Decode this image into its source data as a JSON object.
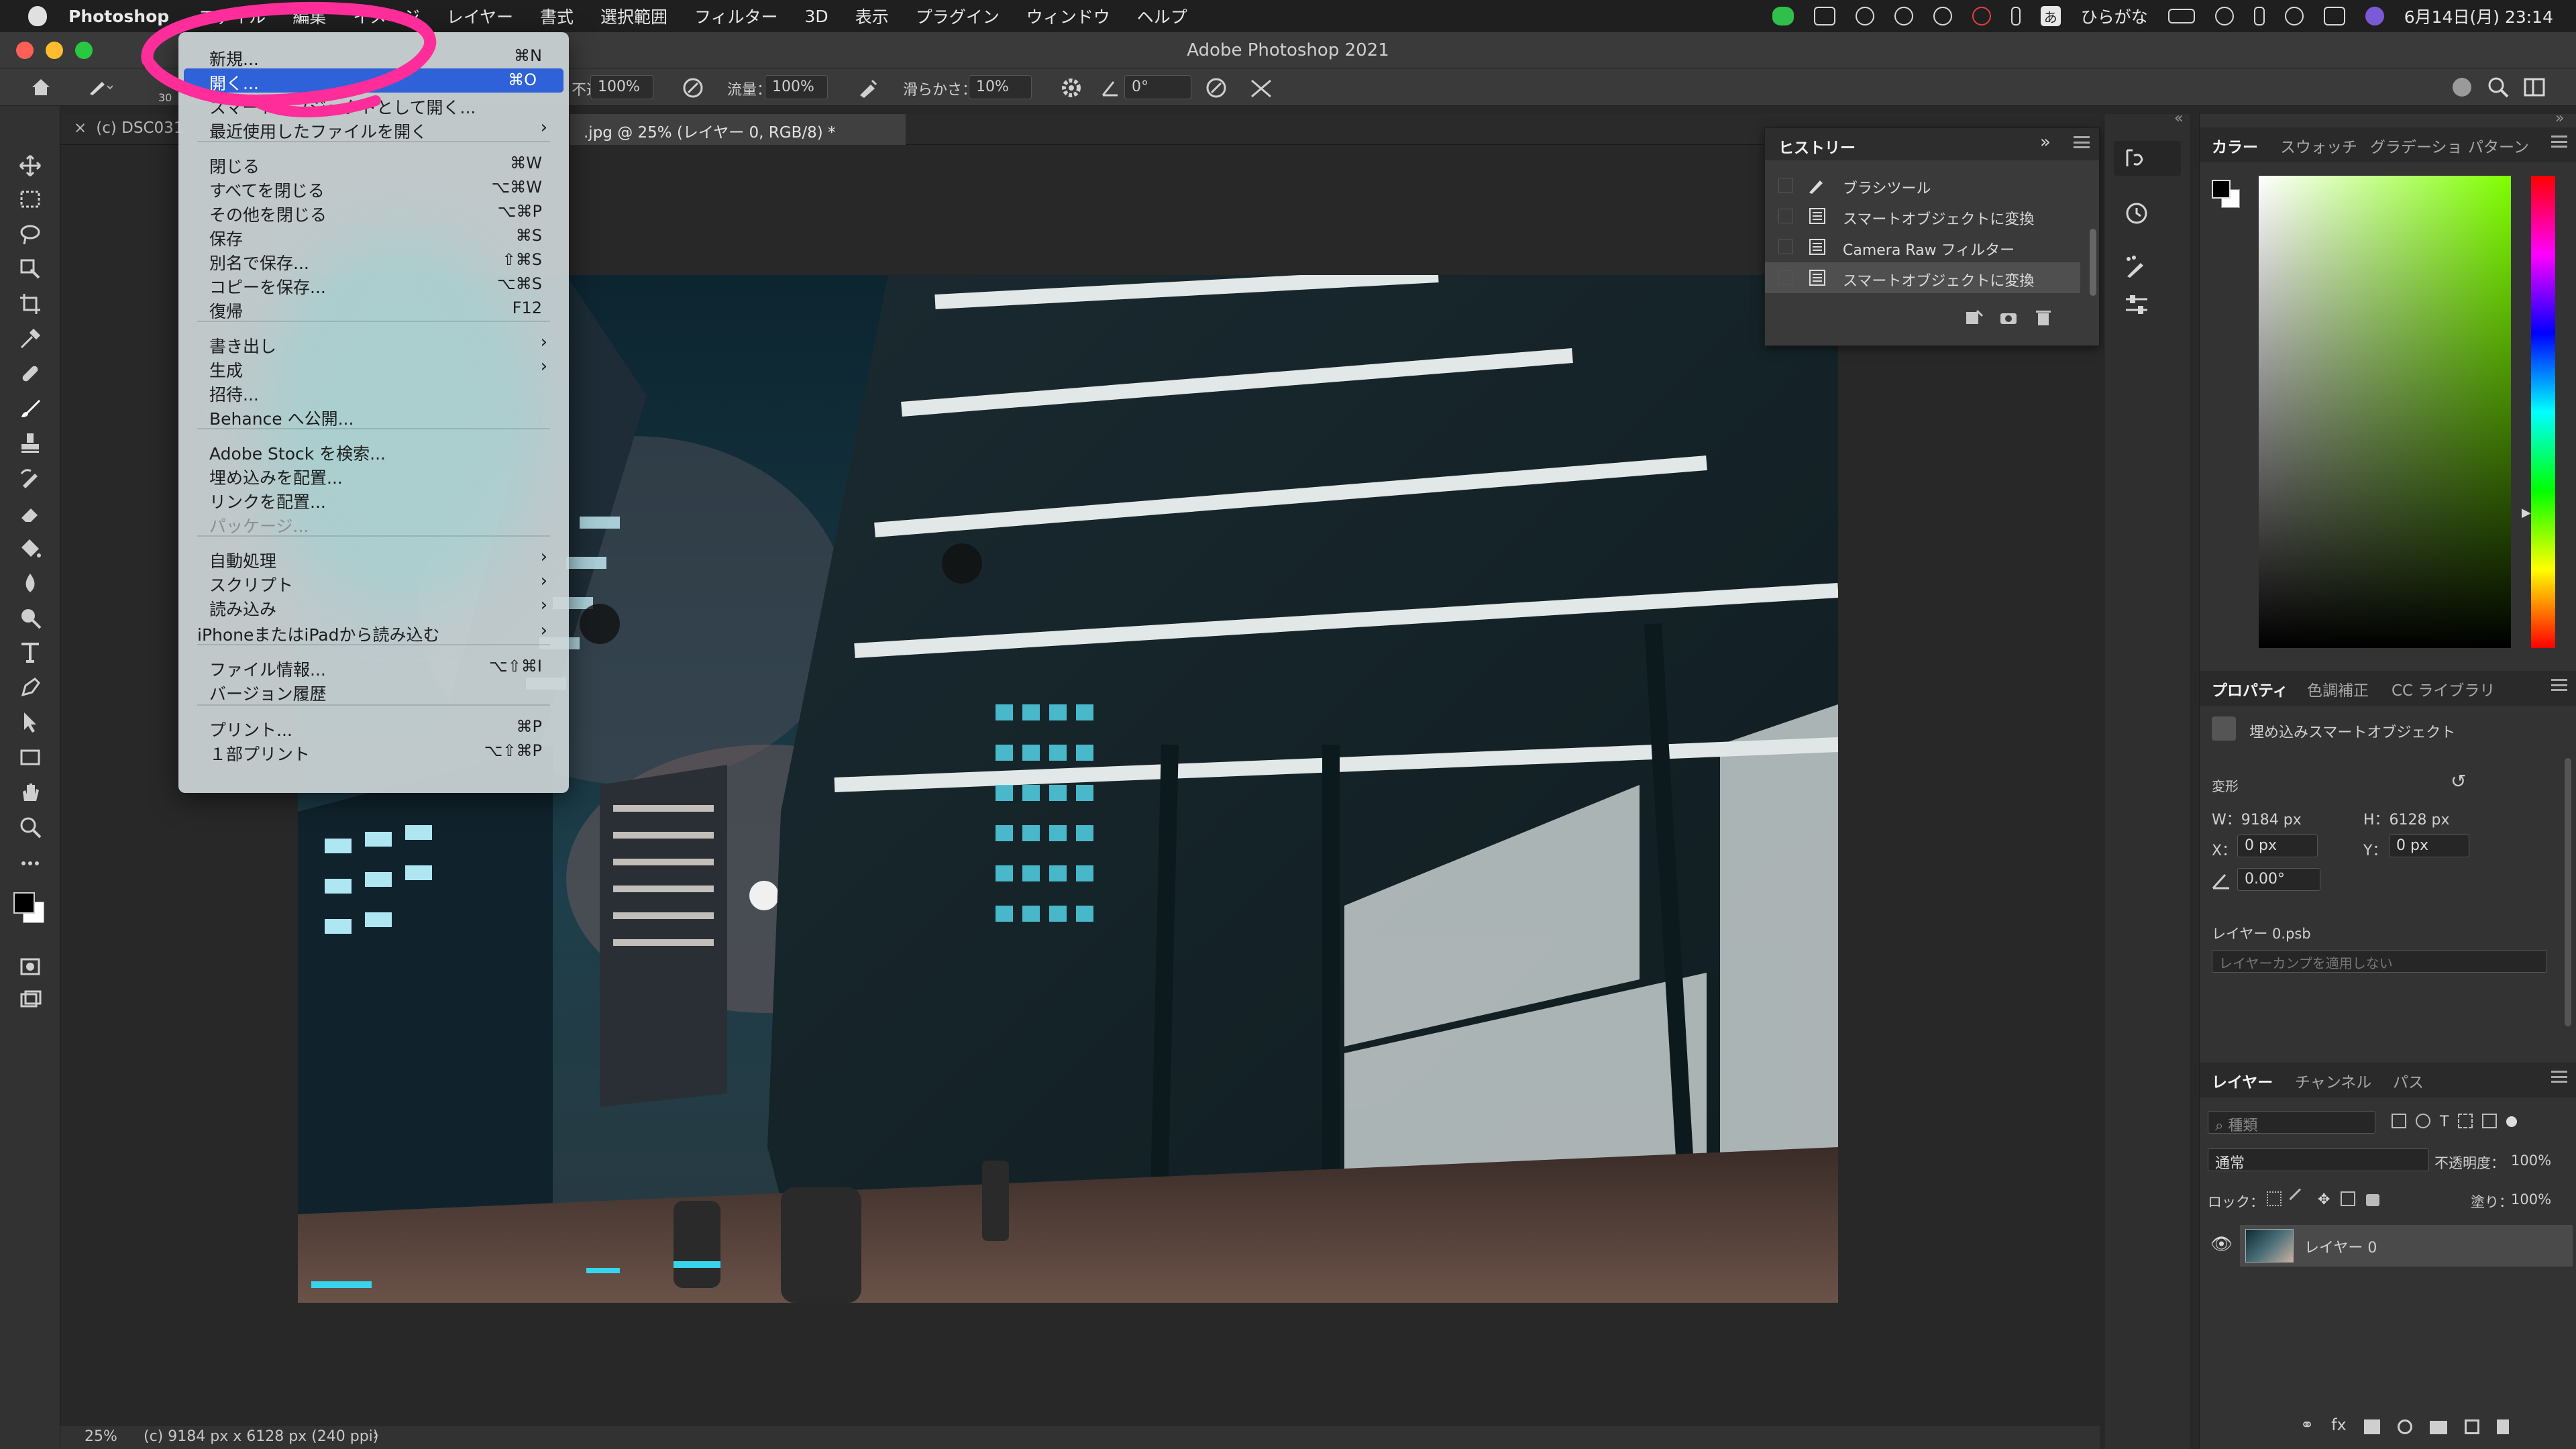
{
  "menubar": {
    "app": "Photoshop",
    "items": [
      "ファイル",
      "編集",
      "イメージ",
      "レイヤー",
      "書式",
      "選択範囲",
      "フィルター",
      "3D",
      "表示",
      "プラグイン",
      "ウィンドウ",
      "ヘルプ"
    ],
    "ime": "ひらがな",
    "ime_badge": "あ",
    "datetime": "6月14日(月)  23:14"
  },
  "window": {
    "title": "Adobe Photoshop 2021"
  },
  "options_bar": {
    "brush_size": "30",
    "opacity_label": "不透明度：",
    "opacity_value": "100%",
    "flow_label": "流量：",
    "flow_value": "100%",
    "smoothing_label": "滑らかさ：",
    "smoothing_value": "10%",
    "angle_value": "0°"
  },
  "tabs": {
    "tab1": "(c) DSC031",
    "tab2": ".jpg @ 25% (レイヤー 0, RGB/8) *"
  },
  "status_bar": {
    "zoom": "25%",
    "doc_info": "(c) 9184 px x 6128 px (240 ppi)"
  },
  "file_menu": {
    "items": [
      {
        "label": "新規...",
        "shortcut": "⌘N"
      },
      {
        "label": "開く...",
        "shortcut": "⌘O"
      },
      {
        "label": "スマートオブジェクトとして開く...",
        "shortcut": ""
      },
      {
        "label": "最近使用したファイルを開く",
        "shortcut": "›"
      },
      {
        "label": "閉じる",
        "shortcut": "⌘W"
      },
      {
        "label": "すべてを閉じる",
        "shortcut": "⌥⌘W"
      },
      {
        "label": "その他を閉じる",
        "shortcut": "⌥⌘P"
      },
      {
        "label": "保存",
        "shortcut": "⌘S"
      },
      {
        "label": "別名で保存...",
        "shortcut": "⇧⌘S"
      },
      {
        "label": "コピーを保存...",
        "shortcut": "⌥⌘S"
      },
      {
        "label": "復帰",
        "shortcut": "F12"
      },
      {
        "label": "書き出し",
        "shortcut": "›"
      },
      {
        "label": "生成",
        "shortcut": "›"
      },
      {
        "label": "招待...",
        "shortcut": ""
      },
      {
        "label": "Behance へ公開...",
        "shortcut": ""
      },
      {
        "label": "Adobe Stock を検索...",
        "shortcut": ""
      },
      {
        "label": "埋め込みを配置...",
        "shortcut": ""
      },
      {
        "label": "リンクを配置...",
        "shortcut": ""
      },
      {
        "label": "パッケージ...",
        "shortcut": ""
      },
      {
        "label": "自動処理",
        "shortcut": "›"
      },
      {
        "label": "スクリプト",
        "shortcut": "›"
      },
      {
        "label": "読み込み",
        "shortcut": "›"
      },
      {
        "label": "iPhoneまたはiPadから読み込む",
        "shortcut": "›"
      },
      {
        "label": "ファイル情報...",
        "shortcut": "⌥⇧⌘I"
      },
      {
        "label": "バージョン履歴",
        "shortcut": ""
      },
      {
        "label": "プリント...",
        "shortcut": "⌘P"
      },
      {
        "label": "１部プリント",
        "shortcut": "⌥⇧⌘P"
      }
    ]
  },
  "history": {
    "title": "ヒストリー",
    "items": [
      "ブラシツール",
      "スマートオブジェクトに変換",
      "Camera Raw フィルター",
      "スマートオブジェクトに変換"
    ]
  },
  "color_panel": {
    "tabs": [
      "カラー",
      "スウォッチ",
      "グラデーショ",
      "パターン"
    ],
    "hue_color": "#7fff00"
  },
  "properties_panel": {
    "tabs": [
      "プロパティ",
      "色調補正",
      "CC ライブラリ"
    ],
    "type": "埋め込みスマートオブジェクト",
    "transform_label": "変形",
    "w": "W：9184 px",
    "h": "H：6128 px",
    "x_label": "X：",
    "x_value": "0 px",
    "y_label": "Y：",
    "y_value": "0 px",
    "angle": "0.00°",
    "layer_file": "レイヤー 0.psb",
    "comp_placeholder": "レイヤーカンプを適用しない"
  },
  "layers_panel": {
    "tabs": [
      "レイヤー",
      "チャンネル",
      "パス"
    ],
    "search_placeholder": "種類",
    "blend_mode": "通常",
    "opacity_label": "不透明度：",
    "opacity_value": "100%",
    "lock_label": "ロック：",
    "fill_label": "塗り：",
    "fill_value": "100%",
    "layer_name": "レイヤー 0"
  }
}
